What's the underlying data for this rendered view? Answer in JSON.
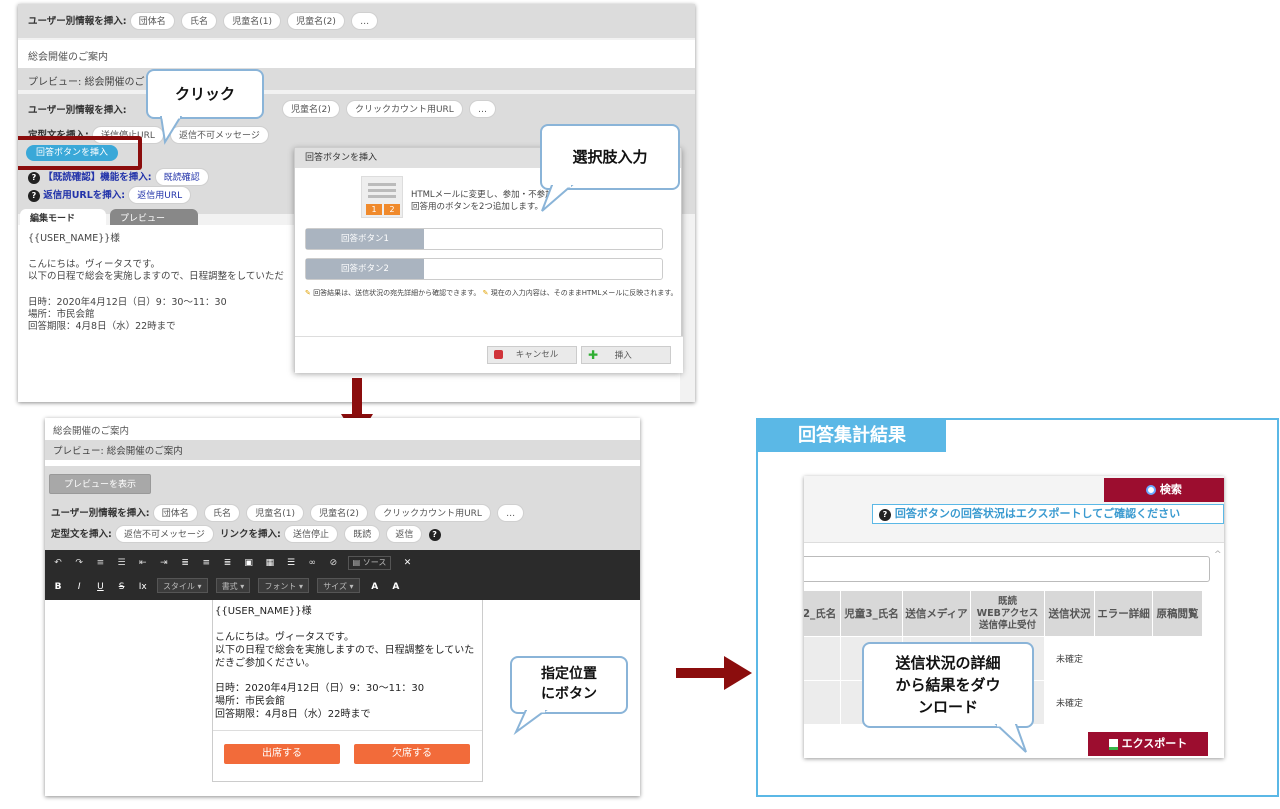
{
  "top": {
    "insert_label": "ユーザー別情報を挿入:",
    "chips": [
      "団体名",
      "氏名",
      "児童名(1)",
      "児童名(2)",
      "…"
    ],
    "subject_value": "総会開催のご案内",
    "preview_subject": "プレビュー: 総会開催のご",
    "insert_label2": "ユーザー別情報を挿入:",
    "chips2": [
      "児童名(2)",
      "クリックカウント用URL",
      "…"
    ],
    "template_label": "定型文を挿入:",
    "template_chips": [
      "送信停止URL",
      "返信不可メッセージ"
    ],
    "answer_button": "回答ボタンを挿入",
    "read_confirm_label": "【既読確認】機能を挿入:",
    "read_confirm_chip": "既読確認",
    "reply_url_label": "返信用URLを挿入:",
    "reply_url_chip": "返信用URL",
    "tab_edit": "編集モード",
    "tab_preview": "プレビュー",
    "body_lines": [
      "{{USER_NAME}}様",
      "",
      "こんにちは。ヴィータスです。",
      "以下の日程で総会を実施しますので、日程調整をしていただ",
      "",
      "日時：2020年4月12日（日）9：30〜11：30",
      "場所：市民会館",
      "回答期限：4月8日（水）22時まで"
    ]
  },
  "dialog": {
    "title": "回答ボタンを挿入",
    "desc1": "HTMLメールに変更し、参加・不参加",
    "desc2": "回答用のボタンを2つ追加します。",
    "thumb_nums": [
      "1",
      "2"
    ],
    "field1_label": "回答ボタン1",
    "field2_label": "回答ボタン2",
    "note1": "回答結果は、送信状況の宛先詳細から確認できます。",
    "note2": "現在の入力内容は、そのままHTMLメールに反映されます。",
    "cancel": "キャンセル",
    "insert": "挿入"
  },
  "bubbles": {
    "click": "クリック",
    "choice_input": "選択肢入力",
    "position_line1": "指定位置",
    "position_line2": "にボタン",
    "status_line1": "送信状況の詳細",
    "status_line2": "から結果をダウ",
    "status_line3": "ンロード"
  },
  "bottom": {
    "subject_value": "総会開催のご案内",
    "preview_subject": "プレビュー: 総会開催のご案内",
    "preview_button": "プレビューを表示",
    "insert_label": "ユーザー別情報を挿入:",
    "chips": [
      "団体名",
      "氏名",
      "児童名(1)",
      "児童名(2)",
      "クリックカウント用URL",
      "…"
    ],
    "template_label": "定型文を挿入:",
    "template_chip": "返信不可メッセージ",
    "link_label": "リンクを挿入:",
    "link_chips": [
      "送信停止",
      "既読",
      "返信"
    ],
    "source_label": "ソース",
    "selects": [
      "スタイル",
      "書式",
      "フォント",
      "サイズ"
    ],
    "body_lines": [
      "{{USER_NAME}}様",
      "",
      "こんにちは。ヴィータスです。",
      "以下の日程で総会を実施しますので、日程調整をしていた",
      "だきご参加ください。",
      "",
      "日時：2020年4月12日（日）9：30〜11：30",
      "場所：市民会館",
      "回答期限：4月8日（水）22時まで"
    ],
    "attend": "出席する",
    "absent": "欠席する"
  },
  "results": {
    "title": "回答集計結果",
    "search": "検索",
    "notice": "回答ボタンの回答状況はエクスポートしてご確認ください",
    "columns": [
      "2_氏名",
      "児童3_氏名",
      "送信メディア",
      "既読\nWEBアクセス\n送信停止受付",
      "送信状況",
      "エラー詳細",
      "原稿閲覧"
    ],
    "rows": [
      [
        "",
        "",
        "",
        "",
        "未確定",
        "",
        ""
      ],
      [
        "",
        "",
        "",
        "",
        "未確定",
        "",
        ""
      ]
    ],
    "export": "エクスポート"
  },
  "colors": {
    "accent_orange": "#f26b3a",
    "dark_red": "#8b0d0d",
    "maroon_button": "#9c0d2f",
    "bubble_border": "#8ab4d8",
    "title_blue": "#5bb8e6"
  }
}
